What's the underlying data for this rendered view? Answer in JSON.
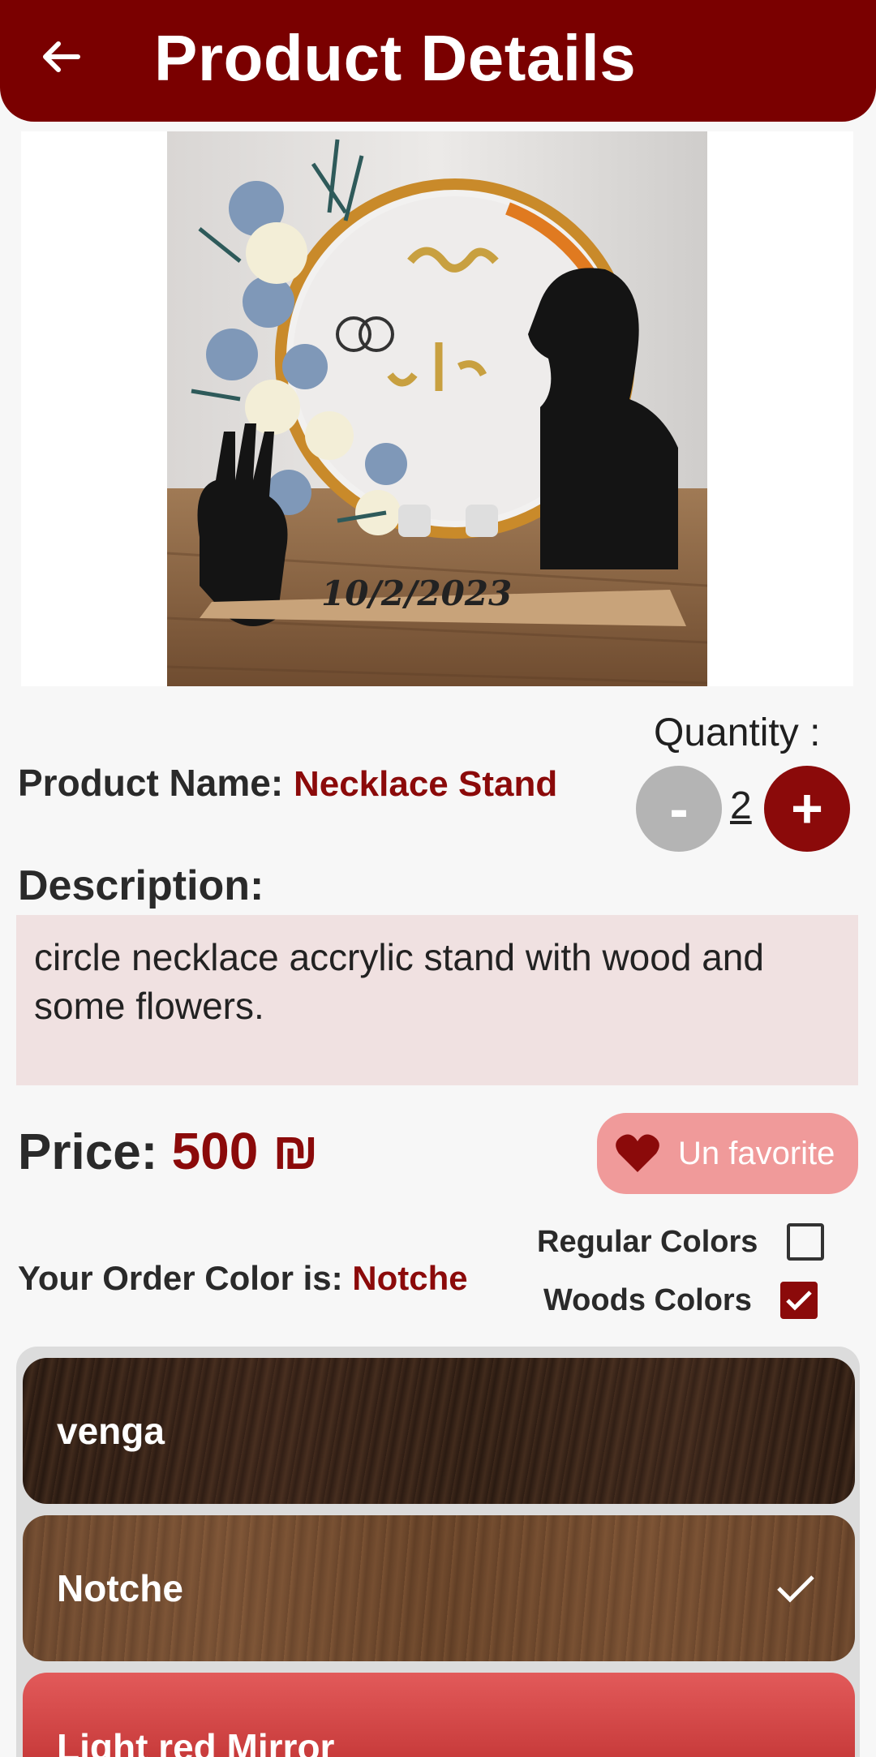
{
  "header": {
    "title": "Product Details"
  },
  "product": {
    "name_label": "Product Name:",
    "name_value": "Necklace Stand",
    "description_heading": "Description:",
    "description_text": "circle necklace accrylic stand with wood and some flowers.",
    "price_label": "Price:",
    "price_value": "500 ₪",
    "favorite_label": "Un favorite",
    "image_text": {
      "date": "10/2/2023"
    }
  },
  "quantity": {
    "label": "Quantity :",
    "minus": "-",
    "value": "2",
    "plus": "+"
  },
  "order_color": {
    "label": "Your Order Color is:",
    "value": "Notche"
  },
  "color_options": {
    "regular": {
      "label": "Regular Colors",
      "checked": false
    },
    "woods": {
      "label": "Woods Colors",
      "checked": true
    }
  },
  "swatches": [
    {
      "label": "venga",
      "selected": false
    },
    {
      "label": "Notche",
      "selected": true
    },
    {
      "label": "Light red Mirror",
      "selected": false
    }
  ],
  "colors": {
    "primary": "#7a0000",
    "accent": "#8b0a0a",
    "favorite_bg": "#f09a9a",
    "description_bg": "#f0e1e1"
  }
}
